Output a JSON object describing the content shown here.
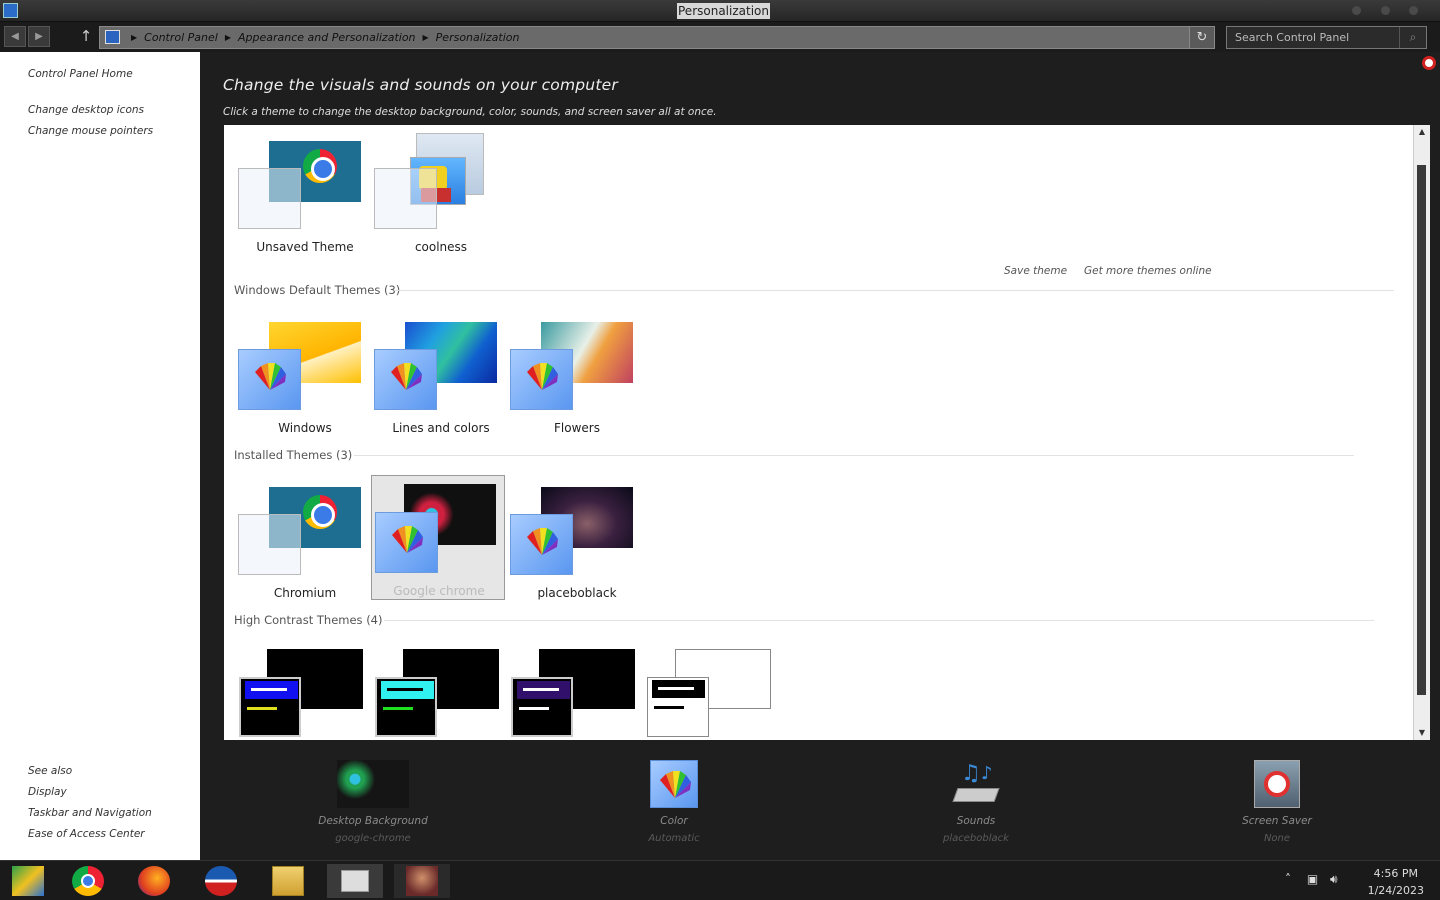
{
  "window": {
    "title": "Personalization"
  },
  "address": {
    "crumbs": [
      "Control Panel",
      "Appearance and Personalization",
      "Personalization"
    ],
    "search_placeholder": "Search Control Panel"
  },
  "sidebar": {
    "top_links": [
      "Control Panel Home",
      "Change desktop icons",
      "Change mouse pointers"
    ],
    "see_also_heading": "See also",
    "see_also": [
      "Display",
      "Taskbar and Navigation",
      "Ease of Access Center"
    ]
  },
  "main": {
    "heading": "Change the visuals and sounds on your computer",
    "subheading": "Click a theme to change the desktop background, color, sounds, and screen saver all at once.",
    "save_theme": "Save theme",
    "get_more": "Get more themes online",
    "my_themes": [
      "Unsaved Theme",
      "coolness"
    ],
    "groups": {
      "default": {
        "label": "Windows Default Themes (3)",
        "themes": [
          "Windows",
          "Lines and colors",
          "Flowers"
        ]
      },
      "installed": {
        "label": "Installed Themes (3)",
        "themes": [
          "Chromium",
          "Google chrome",
          "placeboblack"
        ],
        "selected": "Google chrome"
      },
      "high_contrast": {
        "label": "High Contrast Themes (4)"
      }
    }
  },
  "bottom": {
    "desktop_background": {
      "title": "Desktop Background",
      "value": "google-chrome"
    },
    "color": {
      "title": "Color",
      "value": "Automatic"
    },
    "sounds": {
      "title": "Sounds",
      "value": "placeboblack"
    },
    "screen_saver": {
      "title": "Screen Saver",
      "value": "None"
    }
  },
  "taskbar": {
    "time": "4:56 PM",
    "date": "1/24/2023",
    "apps": [
      "control-panel-icon",
      "chrome-icon",
      "firefox-icon",
      "browser-icon",
      "file-explorer-icon",
      "store-icon",
      "photo-icon"
    ]
  }
}
